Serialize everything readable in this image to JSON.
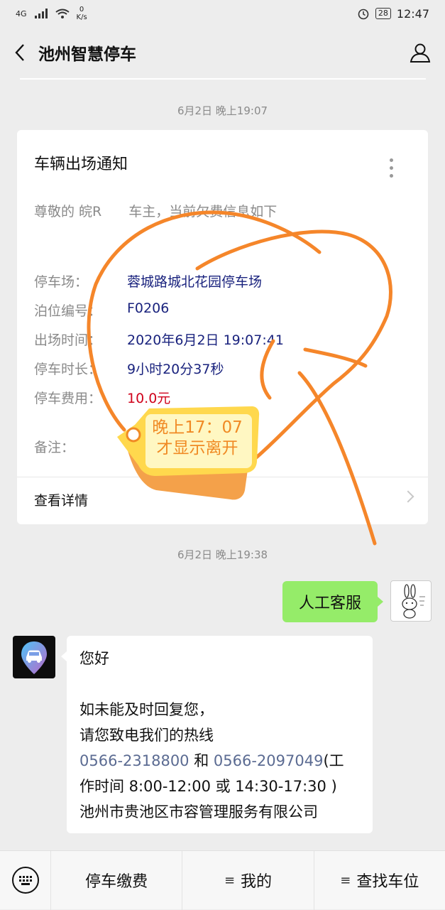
{
  "status": {
    "network": "4G",
    "speed": "0\nK/s",
    "battery": "28",
    "time": "12:47"
  },
  "nav": {
    "title": "池州智慧停车"
  },
  "messages": {
    "ts1": "6月2日 晚上19:07",
    "ts2": "6月2日 晚上19:38"
  },
  "card": {
    "title": "车辆出场通知",
    "greeting": "尊敬的 皖R　　车主，当前欠费信息如下",
    "fields": [
      {
        "label": "停车场：",
        "value": "蓉城路城北花园停车场"
      },
      {
        "label": "泊位编号：",
        "value": "F0206"
      },
      {
        "label": "出场时间：",
        "value": "2020年6月2日 19:07:41"
      },
      {
        "label": "停车时长：",
        "value": "9小时20分37秒"
      },
      {
        "label": "停车费用：",
        "value": "10.0元"
      },
      {
        "label": "备注：",
        "value": ""
      }
    ],
    "footer": "查看详情"
  },
  "user_msg": "人工客服",
  "bot_msg": {
    "line1": "您好",
    "line2": "如未能及时回复您，",
    "line3": "请您致电我们的热线",
    "phone1": "0566-2318800",
    "and": " 和 ",
    "phone2": "0566-2097049",
    "line4a": "(工",
    "line5": "作时间 8:00-12:00 或 14:30-17:30 )",
    "line6": "池州市贵池区市容管理服务有限公司"
  },
  "annotation": {
    "line1": "晚上17：07",
    "line2": "才显示离开",
    "color": "#f08a24"
  },
  "bottom_menu": [
    "停车缴费",
    "我的",
    "查找车位"
  ]
}
